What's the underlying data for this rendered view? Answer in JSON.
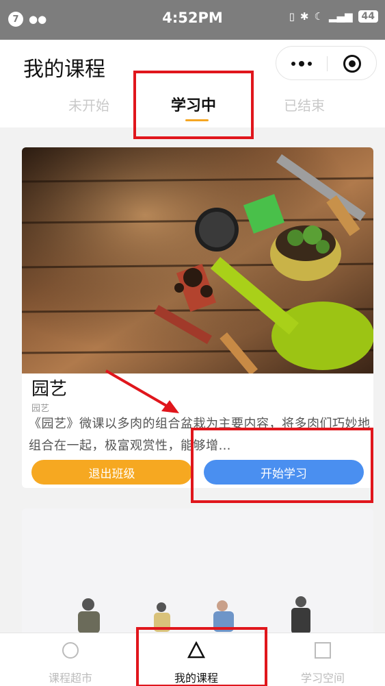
{
  "status_bar": {
    "notification_count": "7",
    "time": "4:52PM",
    "network": "4G",
    "battery": "44"
  },
  "header": {
    "title": "我的课程",
    "more_icon": "more-dots-icon",
    "close_icon": "target-close-icon"
  },
  "tabs": [
    {
      "label": "未开始",
      "active": false
    },
    {
      "label": "学习中",
      "active": true
    },
    {
      "label": "已结束",
      "active": false
    }
  ],
  "course": {
    "name": "园艺",
    "category": "园艺",
    "description": "《园艺》微课以多肉的组合盆栽为主要内容，将多肉们巧妙地组合在一起，极富观赏性，能够增…",
    "exit_button": "退出班级",
    "start_button": "开始学习"
  },
  "bottom_nav": [
    {
      "label": "课程超市",
      "icon": "circle-icon",
      "active": false
    },
    {
      "label": "我的课程",
      "icon": "triangle-icon",
      "active": true
    },
    {
      "label": "学习空间",
      "icon": "square-icon",
      "active": false
    }
  ],
  "colors": {
    "accent": "#f5a623",
    "exit_button": "#f6a821",
    "start_button": "#4a8ff0",
    "annotation_red": "#e0161c"
  }
}
